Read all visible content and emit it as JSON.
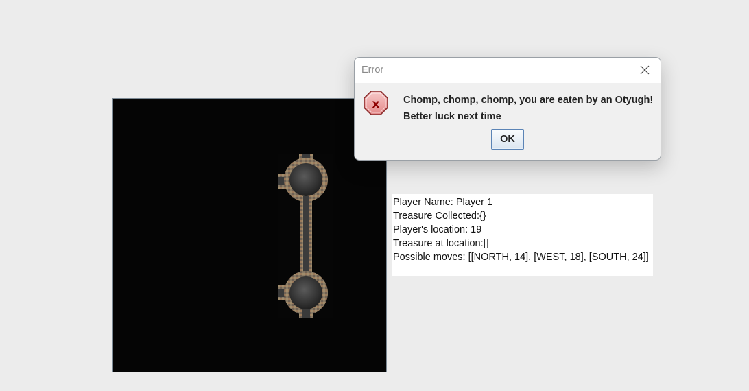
{
  "dialog": {
    "title": "Error",
    "message_line1": "Chomp, chomp, chomp, you are eaten by an Otyugh!",
    "message_line2": "Better luck next time",
    "ok_label": "OK",
    "icon": "error-icon"
  },
  "info": {
    "lines": [
      "Player Name: Player 1",
      "Treasure Collected:{}",
      "Player's location: 19",
      "Treasure at location:[]",
      "Possible moves: [[NORTH, 14], [WEST, 18], [SOUTH, 24]]"
    ]
  }
}
